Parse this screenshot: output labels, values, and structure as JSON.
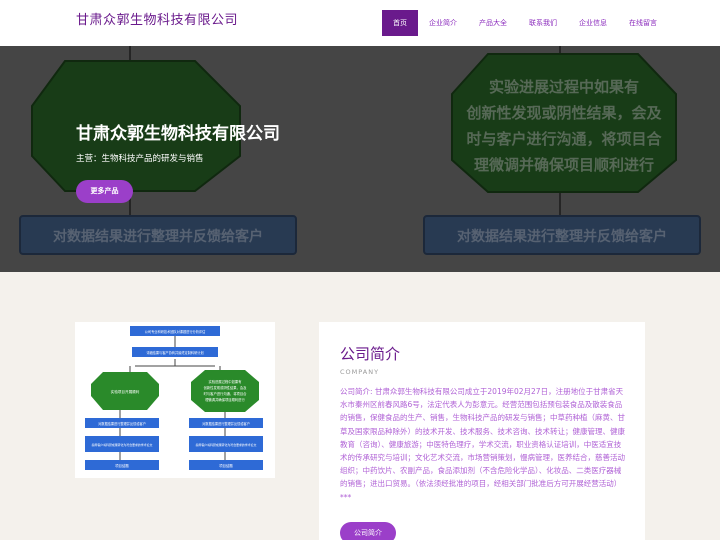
{
  "header": {
    "logo": "甘肃众郭生物科技有限公司",
    "nav": [
      "首页",
      "企业简介",
      "产品大全",
      "联系我们",
      "企业信息",
      "在线留言"
    ]
  },
  "hero": {
    "title": "甘肃众郭生物科技有限公司",
    "subtitle": "主营：生物科技产品的研发与销售",
    "button": "更多产品",
    "diagram_left_text": "对数据结果进行整理并反馈给客户",
    "diagram_right_text": "对数据结果进行整理并反馈给客户",
    "diagram_octagon_lines": [
      "实验进展过程中如果有",
      "创新性发现或阴性结果，会及",
      "时与客户进行沟通，将项目合",
      "理微调并确保项目顺利进行"
    ]
  },
  "flowchart": {
    "top_boxes": [
      "公司专业科研技术团队对课题进行分析评估",
      "详细结果与客户协商并最终定制科研计划"
    ],
    "left_octagon": "实验项目开展顺利",
    "right_octagon_lines": [
      "实验进展过程中如果有",
      "创新性发现或阴性结果，会及",
      "时与客户进行沟通，将项目合",
      "理微调并确保项目顺利进行"
    ],
    "left_boxes": [
      "对数据结果进行整理并反馈给客户",
      "指导客户将科研成果转化为符合要求的学术论文",
      "项目结题"
    ],
    "right_boxes": [
      "对数据结果进行整理并反馈给客户",
      "指导客户将科研成果转化为符合要求的学术论文",
      "项目结题"
    ]
  },
  "about": {
    "title": "公司简介",
    "subtitle": "COMPANY",
    "text": "公司简介: 甘肃众郭生物科技有限公司成立于2019年02月27日，注册地位于甘肃省天水市秦州区前春风路6号，法定代表人为彭意元。经营范围包括预包装食品及散装食品的销售，保健食品的生产、销售，生物科技产品的研发与销售；中草药种植（麻黄、甘草及国家限品种除外）的技术开发、技术服务、技术咨询、技术转让；健康管理、健康教育（咨询）、健康旅游；中医特色理疗，学术交流，职业资格认证培训，中医适宜技术的传承研究与培训；文化艺术交流，市场营销策划，慢病管理，医养结合，慈善活动组织；中药饮片、农副产品，食品添加剂（不含危险化学品）、化妆品、二类医疗器械的销售；进出口贸易。（依法须经批准的项目，经相关部门批准后方可开展经营活动）***",
    "button": "公司简介"
  }
}
